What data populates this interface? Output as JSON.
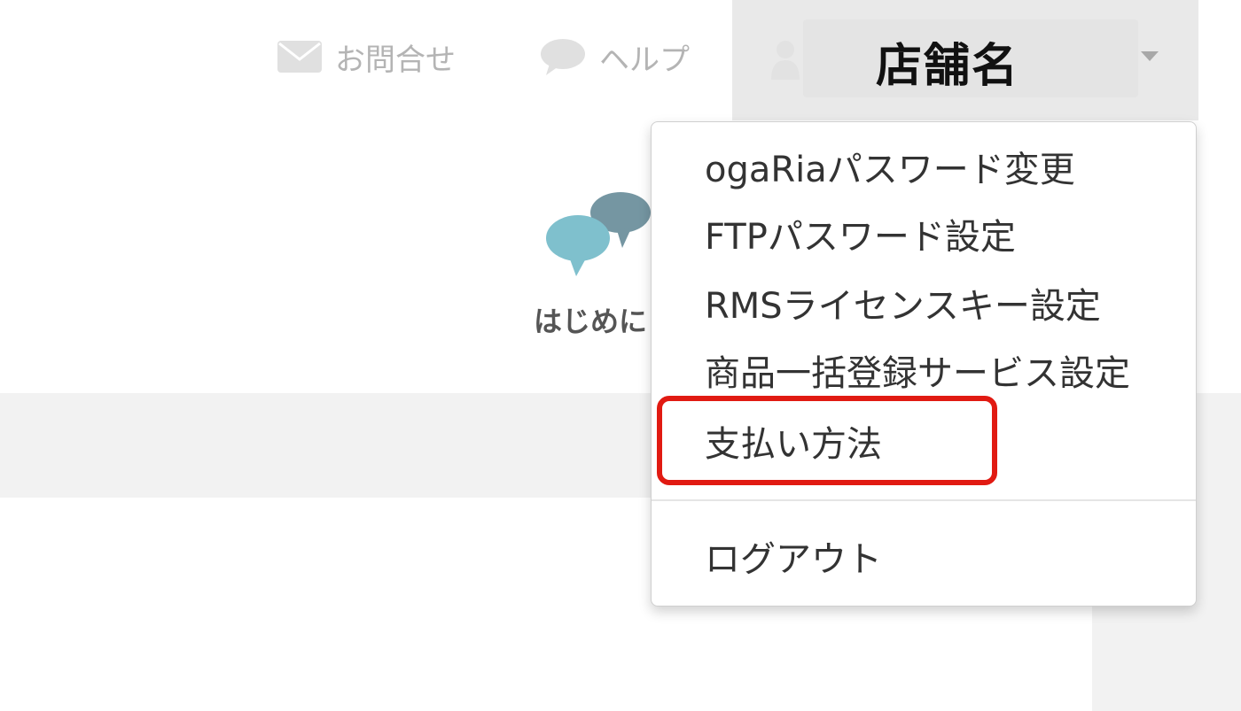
{
  "header": {
    "contact_label": "お問合せ",
    "help_label": "ヘルプ",
    "store_name": "店舗名"
  },
  "feature": {
    "label": "はじめに"
  },
  "menu": {
    "items": [
      {
        "label": "ogaRiaパスワード変更"
      },
      {
        "label": "FTPパスワード設定"
      },
      {
        "label": "RMSライセンスキー設定"
      },
      {
        "label": "商品一括登録サービス設定"
      },
      {
        "label": "支払い方法"
      }
    ],
    "logout_label": "ログアウト",
    "highlighted_item": "支払い方法"
  },
  "colors": {
    "highlight": "#e11a12",
    "nav_text": "#b4b4b4",
    "bubble_front": "#7fc0cd",
    "bubble_back": "#7596a2"
  },
  "icons": {
    "contact": "envelope-icon",
    "help": "speech-bubble-icon",
    "user": "user-icon",
    "caret": "caret-down-icon",
    "feature": "chat-bubbles-icon"
  }
}
